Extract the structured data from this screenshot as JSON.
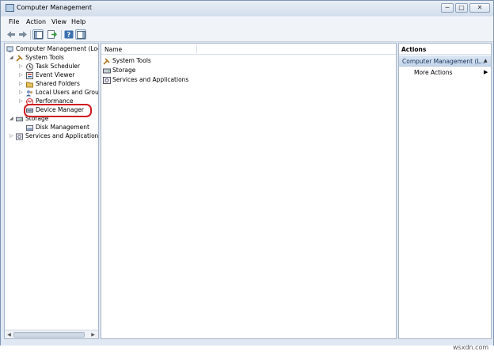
{
  "window": {
    "title": "Computer Management"
  },
  "title_buttons": {
    "minimize": "─",
    "maximize": "□",
    "close": "✕"
  },
  "menu": [
    "File",
    "Action",
    "View",
    "Help"
  ],
  "toolbar_icons": [
    "back-arrow-icon",
    "forward-arrow-icon",
    "show-hide-tree-icon",
    "export-list-icon",
    "help-icon",
    "show-hide-action-pane-icon"
  ],
  "tree": {
    "root": "Computer Management (Local",
    "items": [
      {
        "label": "System Tools",
        "icon": "system-tools-icon",
        "expanded": true
      },
      {
        "label": "Task Scheduler",
        "icon": "clock-icon"
      },
      {
        "label": "Event Viewer",
        "icon": "event-viewer-icon"
      },
      {
        "label": "Shared Folders",
        "icon": "shared-folder-icon"
      },
      {
        "label": "Local Users and Groups",
        "icon": "users-icon"
      },
      {
        "label": "Performance",
        "icon": "performance-icon"
      },
      {
        "label": "Device Manager",
        "icon": "device-manager-icon",
        "highlighted": true
      },
      {
        "label": "Storage",
        "icon": "storage-icon",
        "expanded": true
      },
      {
        "label": "Disk Management",
        "icon": "disk-icon"
      },
      {
        "label": "Services and Applications",
        "icon": "services-icon"
      }
    ],
    "highlight_color": "#d0191f"
  },
  "content": {
    "column_header": "Name",
    "rows": [
      {
        "label": "System Tools",
        "icon": "system-tools-icon"
      },
      {
        "label": "Storage",
        "icon": "storage-icon"
      },
      {
        "label": "Services and Applications",
        "icon": "services-icon"
      }
    ]
  },
  "actions": {
    "header": "Actions",
    "section": "Computer Management (L...",
    "section_caret": "▲",
    "more_actions": "More Actions",
    "more_arrow": "▶"
  },
  "scrollbar": {
    "left_arrow": "◀",
    "right_arrow": "▶"
  },
  "watermark": "wsxdn.com"
}
